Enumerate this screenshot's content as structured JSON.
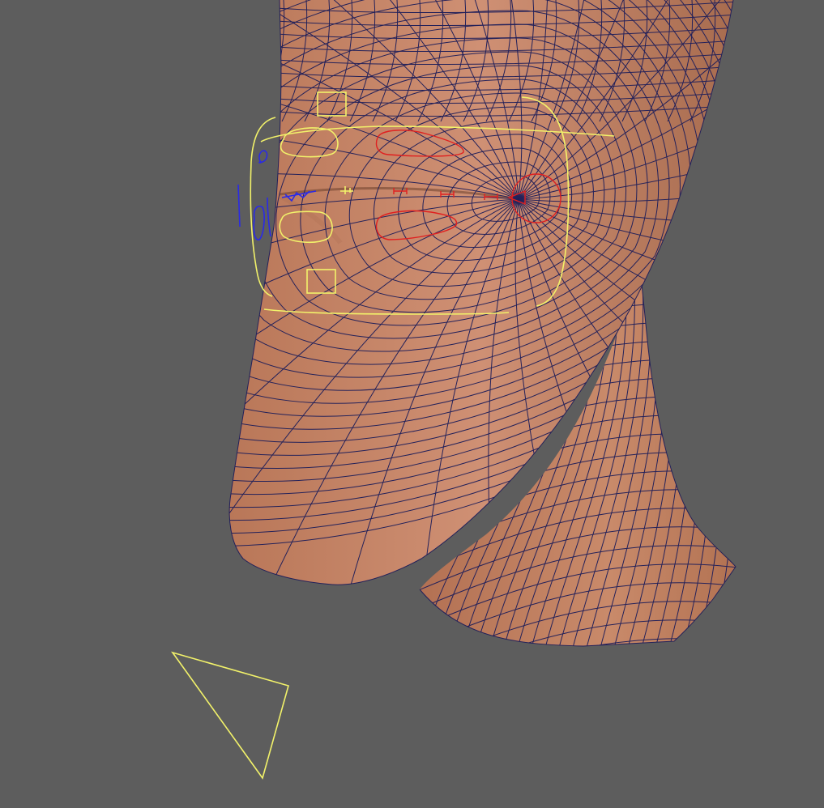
{
  "viewport": {
    "background": "#5d5d5d",
    "skin_color": "#c98a6a",
    "wire_color": "#23215a"
  },
  "mesh": {
    "head": "face-mesh",
    "neck": "neck-mesh"
  },
  "rig_controls": {
    "lip_controls_color": "#f2f26a",
    "cheek_controls_color": "#e02020",
    "jaw_controls_color": "#2a2ae6",
    "items": [
      "mouth-frame-control",
      "upper-lip-box-control",
      "lower-lip-box-control",
      "upper-lip-left-control",
      "lower-lip-left-control",
      "upper-lip-right-control",
      "lower-lip-right-control",
      "mouth-corner-control",
      "jaw-control",
      "camera-look-at-triangle"
    ]
  }
}
